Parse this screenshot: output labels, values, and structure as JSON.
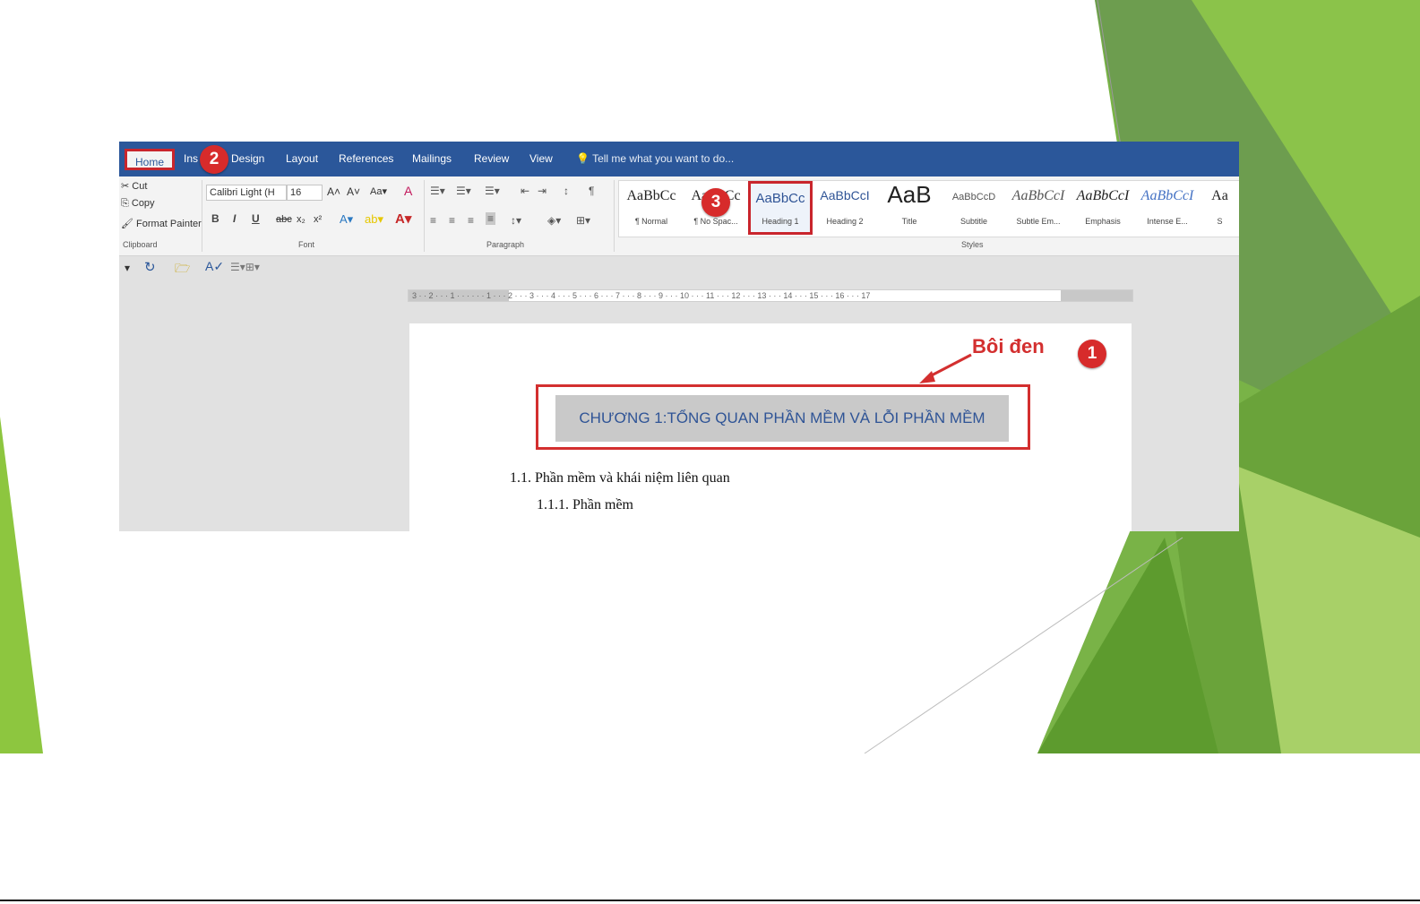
{
  "tabs": [
    "Home",
    "Ins",
    "Design",
    "Layout",
    "References",
    "Mailings",
    "Review",
    "View"
  ],
  "tell_me": "Tell me what you want to do...",
  "clipboard": {
    "cut": "Cut",
    "copy": "Copy",
    "painter": "Format Painter",
    "group": "Clipboard"
  },
  "font": {
    "family": "Calibri Light (H",
    "size": "16",
    "group": "Font",
    "bold": "B",
    "italic": "I",
    "underline": "U"
  },
  "paragraph": {
    "group": "Paragraph"
  },
  "styles": {
    "group": "Styles",
    "items": [
      {
        "preview": "AaBbCc",
        "name": "¶ Normal"
      },
      {
        "preview": "AaBbCc",
        "name": "¶ No Spac..."
      },
      {
        "preview": "AaBbCc",
        "name": "Heading 1"
      },
      {
        "preview": "AaBbCcI",
        "name": "Heading 2"
      },
      {
        "preview": "AaB",
        "name": "Title"
      },
      {
        "preview": "AaBbCcD",
        "name": "Subtitle"
      },
      {
        "preview": "AaBbCcI",
        "name": "Subtle Em..."
      },
      {
        "preview": "AaBbCcI",
        "name": "Emphasis"
      },
      {
        "preview": "AaBbCcI",
        "name": "Intense E..."
      },
      {
        "preview": "Aa",
        "name": "S"
      }
    ]
  },
  "ruler_text": "3 · · 2 · · · 1 · · ·   · · · 1 · · · 2 · · · 3 · · · 4 · · · 5 · · · 6 · · · 7 · · · 8 · · · 9 · · · 10 · · · 11 · · · 12 · · · 13 · · · 14 · · · 15 · · · 16 · · · 17",
  "document": {
    "heading": "CHƯƠNG 1:TỔNG QUAN PHẦN MỀM VÀ LỖI PHẦN MỀM",
    "line1": "1.1. Phần mềm và khái niệm liên quan",
    "line2": "1.1.1. Phần mềm"
  },
  "annotations": {
    "callout": "Bôi đen",
    "badge1": "1",
    "badge2": "2",
    "badge3": "3"
  },
  "colors": {
    "ribbon_blue": "#2b579a",
    "annotation_red": "#d32f2f",
    "slide_green": "#7cb342"
  }
}
